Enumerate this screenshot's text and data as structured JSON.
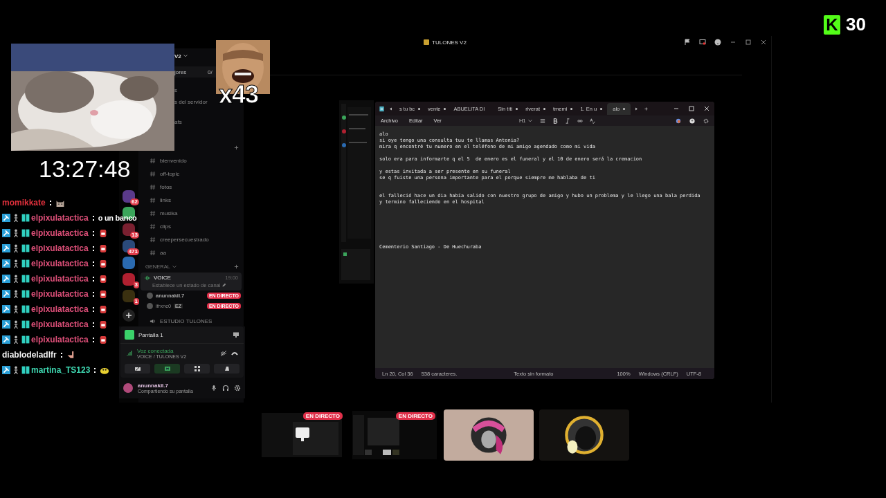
{
  "overlay": {
    "counter_logo": "K",
    "counter": "30",
    "clock": "13:27:48",
    "meme_label": "x43"
  },
  "chat": [
    {
      "user": "momikkate",
      "color": "#e0303c",
      "kind": "plain",
      "emote": {
        "kind": "cat"
      }
    },
    {
      "user": "elpixulatactica",
      "color": "#e0507a",
      "kind": "badged",
      "text": "o un banco"
    },
    {
      "user": "elpixulatactica",
      "color": "#e0507a",
      "kind": "badged",
      "emote": {
        "kind": "face"
      }
    },
    {
      "user": "elpixulatactica",
      "color": "#e0507a",
      "kind": "badged",
      "emote": {
        "kind": "face"
      }
    },
    {
      "user": "elpixulatactica",
      "color": "#e0507a",
      "kind": "badged",
      "emote": {
        "kind": "face"
      }
    },
    {
      "user": "elpixulatactica",
      "color": "#e0507a",
      "kind": "badged",
      "emote": {
        "kind": "face"
      }
    },
    {
      "user": "elpixulatactica",
      "color": "#e0507a",
      "kind": "badged",
      "emote": {
        "kind": "face"
      }
    },
    {
      "user": "elpixulatactica",
      "color": "#e0507a",
      "kind": "badged",
      "emote": {
        "kind": "face"
      }
    },
    {
      "user": "elpixulatactica",
      "color": "#e0507a",
      "kind": "badged",
      "emote": {
        "kind": "face"
      }
    },
    {
      "user": "elpixulatactica",
      "color": "#e0507a",
      "kind": "badged",
      "emote": {
        "kind": "face"
      }
    },
    {
      "user": "diablodeladlfr",
      "color": "#f2f2f2",
      "kind": "plain",
      "emote": {
        "kind": "hand"
      }
    },
    {
      "user": "martina_TS123",
      "color": "#3ed6b0",
      "kind": "badged",
      "emote": {
        "kind": "blob"
      }
    }
  ],
  "discord": {
    "title": "TULONES V2",
    "server_name": "V2",
    "header_tabs": [
      "jores",
      "0/"
    ],
    "top_items": [
      "s",
      "s del servidor",
      "afs"
    ],
    "servers": [
      {
        "color": "#5a3a8a",
        "badge": "62"
      },
      {
        "color": "#3aa55a"
      },
      {
        "color": "#7a2030",
        "badge": "13"
      },
      {
        "color": "#2a4a7a",
        "badge": "471"
      },
      {
        "color": "#2a6ab0"
      },
      {
        "color": "#b02030",
        "badge": "3"
      },
      {
        "color": "#3a3010",
        "badge": "1"
      }
    ],
    "channels": [
      "bienvenido",
      "off-topic",
      "fotos",
      "links",
      "musika",
      "clips",
      "creepersecuestrado",
      "aa"
    ],
    "category": "GENERAL",
    "voice_channel": {
      "name": "VOICE",
      "count": "19:00",
      "status": "Establece un estado de canal",
      "members": [
        {
          "name": "anunnakil.7",
          "badge": "EN DIRECTO"
        },
        {
          "name": "ifrxnc0",
          "tag": "EZ",
          "badge": "EN DIRECTO"
        }
      ]
    },
    "voice_channel_2": "ESTUDIO TULONES",
    "stream_panel": "Pantalla 1",
    "connection": {
      "status": "Voz conectada",
      "channel": "VOICE / TULONES V2"
    },
    "user": {
      "name": "anunnakil.7",
      "status": "Compartiendo su pantalla"
    },
    "tiles": [
      {
        "kind": "screen",
        "badge": "EN DIRECTO"
      },
      {
        "kind": "screen2",
        "badge": "EN DIRECTO"
      },
      {
        "kind": "avatar-pink"
      },
      {
        "kind": "avatar-gold"
      }
    ]
  },
  "notepad": {
    "tabs": [
      {
        "label": "s tu bc",
        "selected": false,
        "modified": true
      },
      {
        "label": "vente",
        "selected": false,
        "modified": true
      },
      {
        "label": "ABUELITA DI",
        "selected": false,
        "modified": false
      },
      {
        "label": "Sin títi",
        "selected": false,
        "modified": true
      },
      {
        "label": "riverat",
        "selected": false,
        "modified": true
      },
      {
        "label": "tmemi",
        "selected": false,
        "modified": true
      },
      {
        "label": "1. En u",
        "selected": false,
        "modified": true
      },
      {
        "label": "alo",
        "selected": true,
        "modified": true
      }
    ],
    "menu": [
      "Archivo",
      "Editar",
      "Ver"
    ],
    "heading_menu": "H1",
    "paragraphs": [
      [
        "alo",
        "si oye tengo una consulta tuu te llamas Antonia?",
        "mira q encontré tu numero en el teléfono de mi amigo agendado como mi vida"
      ],
      [
        "solo era para informarte q el 5  de enero es el funeral y el 10 de enero será la cremacion"
      ],
      [
        "y estas invitada a ser presente en su funeral",
        "se q fuiste una persona importante para el porque siempre me hablaba de ti"
      ],
      [
        "el falleció hace un dia había salido con nuestro grupo de amigo y hubo un problema y le llego una bala perdida",
        "y termino falleciendo en el hospital"
      ],
      [
        "Cementerio Santiago - De Huechuraba"
      ]
    ],
    "status": {
      "position": "Ln 20, Col 36",
      "characters": "538 caracteres.",
      "format": "Texto sin formato",
      "zoom": "100%",
      "line_ending": "Windows (CRLF)",
      "encoding": "UTF-8"
    }
  }
}
